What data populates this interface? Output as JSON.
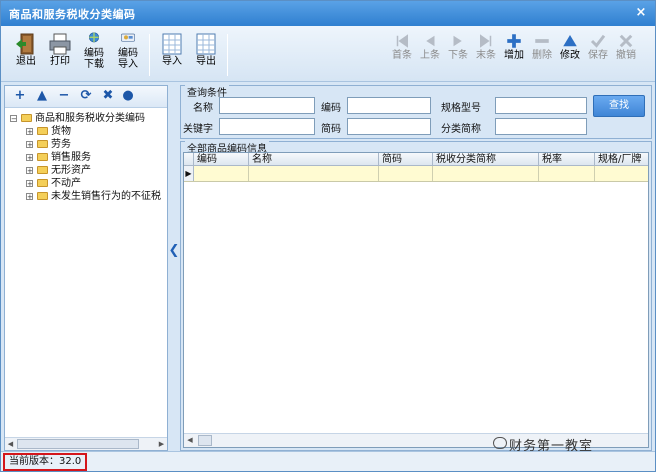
{
  "window": {
    "title": "商品和服务税收分类编码",
    "close_glyph": "×"
  },
  "toolbar": {
    "left_buttons": [
      {
        "label": "退出",
        "icon": "exit-door-icon"
      },
      {
        "label": "打印",
        "icon": "printer-icon"
      },
      {
        "label": "编码",
        "label2": "下载",
        "icon": "globe-download-icon"
      },
      {
        "label": "编码",
        "label2": "导入",
        "icon": "import-icon"
      },
      {
        "label": "导入",
        "icon": "spreadsheet-import-icon"
      },
      {
        "label": "导出",
        "icon": "spreadsheet-export-icon"
      }
    ],
    "right_buttons": [
      {
        "label": "首条",
        "enabled": false,
        "icon": "first-record-icon"
      },
      {
        "label": "上条",
        "enabled": false,
        "icon": "prev-record-icon"
      },
      {
        "label": "下条",
        "enabled": false,
        "icon": "next-record-icon"
      },
      {
        "label": "末条",
        "enabled": false,
        "icon": "last-record-icon"
      },
      {
        "label": "增加",
        "enabled": true,
        "icon": "plus-icon"
      },
      {
        "label": "删除",
        "enabled": false,
        "icon": "minus-icon"
      },
      {
        "label": "修改",
        "enabled": true,
        "icon": "edit-triangle-icon"
      },
      {
        "label": "保存",
        "enabled": false,
        "icon": "check-icon"
      },
      {
        "label": "撤销",
        "enabled": false,
        "icon": "cross-icon"
      }
    ]
  },
  "tree_toolbar": [
    "+",
    "▲",
    "−",
    "⟳",
    "✖",
    "●"
  ],
  "tree": {
    "root": "商品和服务税收分类编码",
    "children": [
      "货物",
      "劳务",
      "销售服务",
      "无形资产",
      "不动产",
      "未发生销售行为的不征税"
    ]
  },
  "query": {
    "legend": "查询条件",
    "labels": {
      "name": "名称",
      "code": "编码",
      "spec": "规格型号",
      "keyword": "关键字",
      "short_code": "简码",
      "category_short": "分类简称"
    },
    "values": {
      "name": "",
      "code": "",
      "spec": "",
      "keyword": "",
      "short_code": "",
      "category_short": ""
    },
    "search_button": "查找"
  },
  "grid": {
    "legend": "全部商品编码信息",
    "columns": [
      "编码",
      "名称",
      "简码",
      "税收分类简称",
      "税率",
      "规格/厂牌"
    ],
    "rows": [
      [
        "",
        "",
        "",
        "",
        "",
        ""
      ]
    ],
    "row_marker": "▶"
  },
  "collapse_arrow": "❮",
  "status": {
    "version": "当前版本：32.0"
  },
  "watermark": "财务第一教室",
  "colors": {
    "accent": "#2f7fd0",
    "version_highlight": "#d4161b",
    "row_highlight": "#fffbd2"
  }
}
